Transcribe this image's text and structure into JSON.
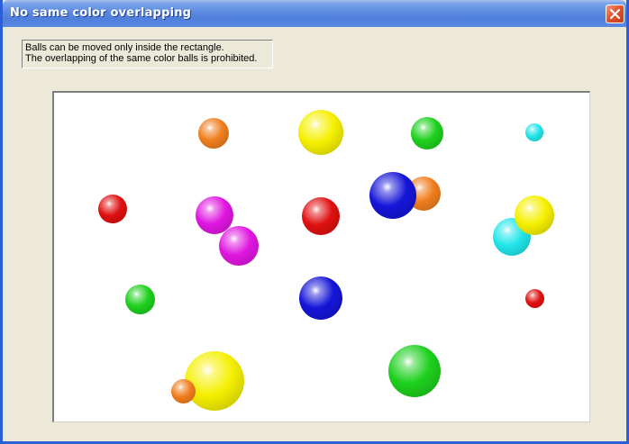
{
  "window": {
    "title": "No same color overlapping",
    "close_icon": "close-icon"
  },
  "info": {
    "line1": "Balls can be moved only inside the rectangle.",
    "line2": "The overlapping of the same color balls is prohibited."
  },
  "colors": {
    "orange": "#f07e1e",
    "yellow": "#f5f000",
    "green": "#1ed01e",
    "cyan": "#20e6ea",
    "red": "#e01010",
    "blue": "#1515d8",
    "magenta": "#e016e0"
  },
  "balls": [
    {
      "color": "orange",
      "size": "medium"
    },
    {
      "color": "yellow",
      "size": "large"
    },
    {
      "color": "green",
      "size": "medium"
    },
    {
      "color": "cyan",
      "size": "small"
    },
    {
      "color": "red",
      "size": "medium"
    },
    {
      "color": "magenta",
      "size": "medium"
    },
    {
      "color": "red",
      "size": "medium"
    },
    {
      "color": "orange",
      "size": "medium"
    },
    {
      "color": "blue",
      "size": "large"
    },
    {
      "color": "cyan",
      "size": "medium"
    },
    {
      "color": "yellow",
      "size": "medium"
    },
    {
      "color": "magenta",
      "size": "medium"
    },
    {
      "color": "green",
      "size": "medium"
    },
    {
      "color": "blue",
      "size": "large"
    },
    {
      "color": "red",
      "size": "small"
    },
    {
      "color": "yellow",
      "size": "xlarge"
    },
    {
      "color": "orange",
      "size": "medium"
    },
    {
      "color": "green",
      "size": "xlarge"
    }
  ]
}
